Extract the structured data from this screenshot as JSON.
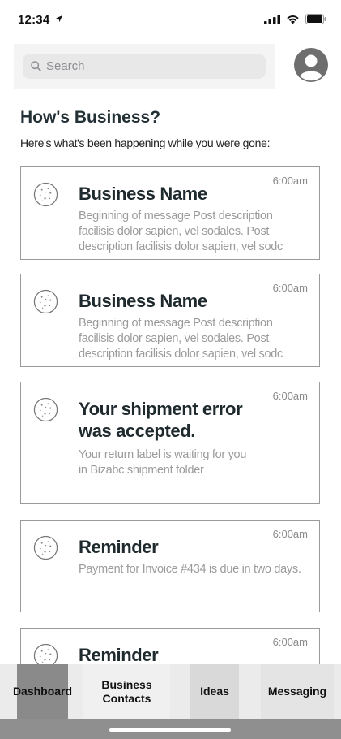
{
  "status_bar": {
    "time": "12:34"
  },
  "header": {
    "search_placeholder": "Search"
  },
  "dashboard": {
    "title": "How's Business?",
    "subtitle": "Here's what's been happening while you were gone:"
  },
  "feed": [
    {
      "title": "Business Name",
      "time": "6:00am",
      "body": "Beginning of message Post description facilisis dolor sapien, vel sodales.  Post description facilisis dolor sapien, vel sodc",
      "icon": "cookie-icon"
    },
    {
      "title": "Business Name",
      "time": "6:00am",
      "body": "Beginning of message Post description facilisis dolor sapien, vel sodales.  Post description facilisis dolor sapien, vel sodc",
      "icon": "cookie-icon"
    },
    {
      "title": "Your shipment error was accepted.",
      "time": "6:00am",
      "body": "Your return label is waiting for you in Bizabc shipment folder",
      "icon": "cookie-icon"
    },
    {
      "title": "Reminder",
      "time": "6:00am",
      "body": "Payment for Invoice #434 is due in two days.",
      "icon": "cookie-icon"
    },
    {
      "title": "Reminder",
      "time": "6:00am",
      "body": "",
      "icon": "cookie-icon"
    }
  ],
  "bottom_nav": {
    "items": [
      {
        "label": "Dashboard",
        "active": true
      },
      {
        "label": "Business Contacts",
        "active": false
      },
      {
        "label": "Ideas",
        "active": false
      },
      {
        "label": "Messaging",
        "active": false
      }
    ]
  },
  "colors": {
    "active_tab": "#8a8a8a",
    "title_text": "#233036",
    "muted_text": "#9b9b9b"
  }
}
